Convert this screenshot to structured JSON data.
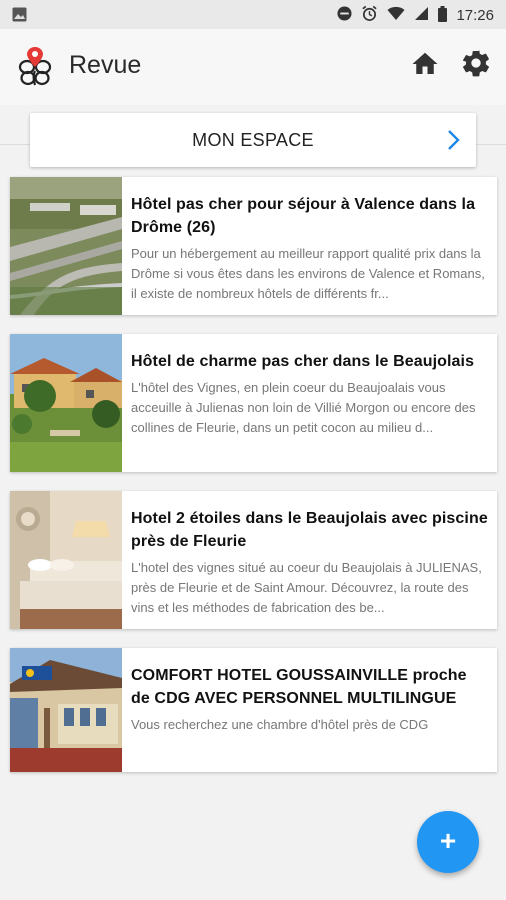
{
  "status_bar": {
    "time": "17:26",
    "icons": [
      "image-icon",
      "dnd-icon",
      "alarm-icon",
      "wifi-icon",
      "signal-icon",
      "battery-icon"
    ]
  },
  "app_bar": {
    "title": "Revue",
    "icons": [
      "flower-logo-icon",
      "home-icon",
      "settings-icon"
    ]
  },
  "espace": {
    "label": "MON ESPACE",
    "chevron_color": "#1e88e5"
  },
  "articles": [
    {
      "title": "Hôtel pas cher pour séjour à Valence dans la Drôme (26)",
      "description": "Pour un hébergement au meilleur rapport qualité prix dans la Drôme si vous êtes dans les environs de Valence et Romans, il existe de nombreux hôtels de différents fr..."
    },
    {
      "title": "Hôtel de charme pas cher dans le Beaujolais",
      "description": "L'hôtel des Vignes, en plein coeur du Beaujoalais vous acceuille à Julienas non loin de Villié Morgon ou encore des collines de Fleurie, dans un petit cocon au milieu d..."
    },
    {
      "title": "Hotel 2 étoiles dans le Beaujolais avec piscine près de Fleurie",
      "description": "L'hotel des vignes situé au coeur du Beaujolais à JULIENAS, près de Fleurie et de Saint Amour. Découvrez, la route des vins et les méthodes de fabrication des be..."
    },
    {
      "title": "COMFORT HOTEL GOUSSAINVILLE proche de  CDG AVEC PERSONNEL MULTILINGUE",
      "description": "Vous recherchez une chambre d'hôtel près de CDG"
    }
  ],
  "fab": {
    "label": "+",
    "color": "#2196f3"
  }
}
